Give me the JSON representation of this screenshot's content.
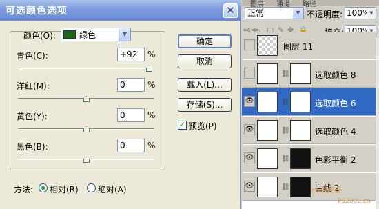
{
  "dialog": {
    "title": "可选颜色选项",
    "close_glyph": "✕",
    "colors_label": "颜色(O):",
    "colors_value": "绿色",
    "colors_swatch": "#1a6a1a",
    "sliders": [
      {
        "label": "青色(C):",
        "value": "+92",
        "unit": "%",
        "level": 0.96
      },
      {
        "label": "洋红(M):",
        "value": "0",
        "unit": "%",
        "level": 0.5
      },
      {
        "label": "黄色(Y):",
        "value": "0",
        "unit": "%",
        "level": 0.5
      },
      {
        "label": "黑色(B):",
        "value": "0",
        "unit": "%",
        "level": 0.5
      }
    ],
    "buttons": {
      "ok": "确定",
      "cancel": "取消",
      "load": "载入(L)...",
      "save": "存储(S)..."
    },
    "preview_label": "预览(P)",
    "preview_checked": true,
    "method_label": "方法:",
    "method_relative": "相对(R)",
    "method_absolute": "绝对(A)",
    "method_selected": "relative"
  },
  "layers_panel": {
    "tabs": [
      "图层",
      "通道",
      "路径"
    ],
    "blend_mode": "正常",
    "opacity_label": "不透明度:",
    "opacity_value": "100%",
    "lock_label": "锁定:",
    "fill_label": "填充:",
    "fill_value": "100%",
    "layers": [
      {
        "name": "图层 11",
        "visible": false,
        "selected": false
      },
      {
        "name": "选取颜色 8",
        "visible": false,
        "selected": false
      },
      {
        "name": "选取颜色 6",
        "visible": true,
        "selected": true
      },
      {
        "name": "选取颜色 4",
        "visible": true,
        "selected": false
      },
      {
        "name": "色彩平衡 2",
        "visible": true,
        "selected": false
      },
      {
        "name": "曲线 2",
        "visible": true,
        "selected": false
      }
    ],
    "watermark": "PS爱好者",
    "watermark_url": "PS2000.cn"
  }
}
